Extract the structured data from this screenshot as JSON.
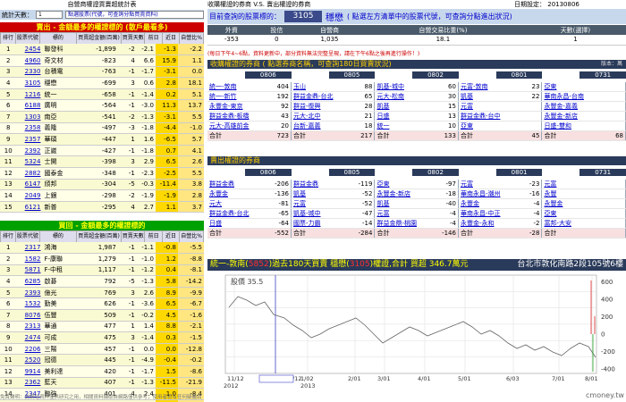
{
  "left": {
    "title": "自營商權證買賣超統計表",
    "days_label": "統計天數：",
    "days_value": "1",
    "search_placeholder": "點選股票(代號，可查詢分點買賣資料)",
    "sell_header": "賣出 - 金額最多的權證標的 (散戶最看多)",
    "buy_header": "買回 - 金額最多的權證標的",
    "columns": [
      "排行",
      "股票代號",
      "標的",
      "買賣超金額(百萬)",
      "買賣天數",
      "前日",
      "近日",
      "自營比%"
    ],
    "sell_rows": [
      [
        "1",
        "2454",
        "聯發科",
        "-1,899",
        "-2",
        "-2.1",
        "-1.3",
        "-2.2"
      ],
      [
        "2",
        "4960",
        "奇文材",
        "-823",
        "4",
        "6.6",
        "15.9",
        "1.1"
      ],
      [
        "3",
        "2330",
        "台積電",
        "-763",
        "-1",
        "-1.7",
        "-3.1",
        "0.0"
      ],
      [
        "4",
        "3105",
        "穩懋",
        "-699",
        "3",
        "0.6",
        "2.8",
        "18.1"
      ],
      [
        "5",
        "1216",
        "統一",
        "-658",
        "-1",
        "-1.4",
        "0.2",
        "5.1"
      ],
      [
        "6",
        "6188",
        "廣明",
        "-564",
        "-1",
        "-3.0",
        "11.3",
        "13.7"
      ],
      [
        "7",
        "1303",
        "南亞",
        "-541",
        "-2",
        "-1.3",
        "-3.1",
        "5.5"
      ],
      [
        "8",
        "2358",
        "義隆",
        "-497",
        "-3",
        "-1.8",
        "-4.4",
        "-1.0"
      ],
      [
        "9",
        "2357",
        "華碩",
        "-447",
        "1",
        "1.6",
        "-6.5",
        "5.7"
      ],
      [
        "10",
        "2392",
        "正崴",
        "-427",
        "-1",
        "-1.8",
        "0.7",
        "4.1"
      ],
      [
        "11",
        "5324",
        "士開",
        "-398",
        "3",
        "2.9",
        "6.5",
        "2.6"
      ],
      [
        "12",
        "2882",
        "國泰金",
        "-348",
        "-1",
        "-2.3",
        "-2.5",
        "5.5"
      ],
      [
        "13",
        "6147",
        "頎邦",
        "-304",
        "-5",
        "-0.3",
        "-11.4",
        "3.8"
      ],
      [
        "14",
        "2049",
        "上銀",
        "-298",
        "-2",
        "-1.9",
        "-1.9",
        "2.8"
      ],
      [
        "15",
        "6121",
        "新普",
        "-295",
        "4",
        "2.7",
        "1.1",
        "3.7"
      ]
    ],
    "buy_rows": [
      [
        "1",
        "2317",
        "鴻海",
        "1,987",
        "-1",
        "-1.1",
        "-0.8",
        "-5.5"
      ],
      [
        "2",
        "1582",
        "F-康聯",
        "1,279",
        "-1",
        "-1.0",
        "1.2",
        "-8.8"
      ],
      [
        "3",
        "5871",
        "F-中租",
        "1,117",
        "-1",
        "-1.2",
        "0.4",
        "-8.1"
      ],
      [
        "4",
        "6285",
        "啟碁",
        "792",
        "-5",
        "-1.3",
        "5.8",
        "-14.2"
      ],
      [
        "5",
        "2393",
        "億光",
        "769",
        "3",
        "2.6",
        "8.9",
        "-9.9"
      ],
      [
        "6",
        "1532",
        "勤美",
        "626",
        "-1",
        "-3.6",
        "6.5",
        "-6.7"
      ],
      [
        "7",
        "8076",
        "伍豐",
        "509",
        "-1",
        "-0.2",
        "4.5",
        "-1.6"
      ],
      [
        "8",
        "2313",
        "華通",
        "477",
        "1",
        "1.4",
        "8.8",
        "-2.1"
      ],
      [
        "9",
        "2474",
        "可成",
        "475",
        "3",
        "-1.4",
        "0.3",
        "-1.5"
      ],
      [
        "10",
        "2206",
        "三陽",
        "457",
        "-1",
        "0.0",
        "0.0",
        "-12.8"
      ],
      [
        "11",
        "2520",
        "冠德",
        "445",
        "-1",
        "-4.9",
        "-0.4",
        "-0.2"
      ],
      [
        "12",
        "9914",
        "美利達",
        "420",
        "-1",
        "-1.7",
        "1.5",
        "-8.6"
      ],
      [
        "13",
        "2362",
        "藍天",
        "407",
        "-1",
        "-1.3",
        "-11.5",
        "-21.9"
      ],
      [
        "14",
        "2347",
        "聯強",
        "401",
        "4",
        "2.4",
        "1.0",
        "-8.4"
      ],
      [
        "15",
        "3008",
        "大立光",
        "357",
        "-1",
        "-1.3",
        "-7.3",
        "-5.7"
      ]
    ],
    "footer": "免責聲明：此網站資料僅供研究之用，相關資料擷取自網路僅供參考，使用者若有任何疑義請以..."
  },
  "right": {
    "title": "收購權證的券商 V.S. 賣出權證的券商",
    "date_label": "日期設定：",
    "date_value": "20130806",
    "query_label": "目前查詢的股票標的：",
    "stock_code": "3105",
    "stock_name": "穩懋",
    "query_hint": "( 點選左方清單中的股票代號，可查詢分點進出狀況)",
    "summary_headers": [
      "外資",
      "投信",
      "自營商",
      "自營交易比重(%)",
      "天數(選擇)"
    ],
    "summary_values": [
      "-353",
      "0",
      "1,035",
      "18.1",
      "1"
    ],
    "note": "(每日下午4~6點，資料更新中，部分資料無法完整呈現，請在下午6點之後再進行操作！)",
    "version": "版本：萬元",
    "buy_brokers_head": "收購權證的券商 ( 點選券商名稱，可查詢180日買賣狀況)",
    "sell_brokers_head": "賣出權證的券商",
    "date_cols": [
      "0806",
      "0805",
      "0802",
      "0801",
      "0731"
    ],
    "buy_brokers": [
      [
        [
          "統一-敦南",
          "404"
        ],
        [
          "玉山",
          "88"
        ],
        [
          "凱基-城中",
          "60"
        ],
        [
          "元富-敦南",
          "23"
        ],
        [
          "亞東",
          ""
        ]
      ],
      [
        [
          "統一-新竹",
          "192"
        ],
        [
          "群益金鼎-台北",
          "65"
        ],
        [
          "元大-松南",
          "30"
        ],
        [
          "凱基",
          "22"
        ],
        [
          "華南永昌-台南",
          ""
        ]
      ],
      [
        [
          "永豐金-東京",
          "92"
        ],
        [
          "群益-復興",
          "28"
        ],
        [
          "凱基",
          "15"
        ],
        [
          "元富",
          "",
          ""
        ],
        [
          "永豐金-嘉義",
          ""
        ]
      ],
      [
        [
          "群益金鼎-板橋",
          "43"
        ],
        [
          "元大-北中",
          "21"
        ],
        [
          "日盛",
          "13"
        ],
        [
          "群益金鼎-台中",
          ""
        ],
        [
          "永豐金-新店",
          ""
        ]
      ],
      [
        [
          "元大-高雄前金",
          "20"
        ],
        [
          "台新-嘉義",
          "18"
        ],
        [
          "統一",
          "10"
        ],
        [
          "亞東",
          ""
        ],
        [
          "日盛-雙和",
          ""
        ]
      ]
    ],
    "buy_brokers_vals": [
      [
        "404",
        "88",
        "60",
        "23",
        ""
      ],
      [
        "192",
        "65",
        "30",
        "22",
        ""
      ],
      [
        "92",
        "28",
        "15",
        "",
        ""
      ],
      [
        "43",
        "21",
        "13",
        "",
        ""
      ],
      [
        "20",
        "18",
        "10",
        "",
        ""
      ]
    ],
    "buy_totals": [
      "723",
      "217",
      "133",
      "45",
      "68"
    ],
    "sell_brokers": [
      [
        [
          "群益金鼎",
          "-206"
        ],
        [
          "群益金鼎",
          "-119"
        ],
        [
          "亞東",
          "-97"
        ],
        [
          "元富",
          "-23"
        ],
        [
          "元富",
          ""
        ]
      ],
      [
        [
          "永豐金",
          "-136"
        ],
        [
          "凱基",
          "-52"
        ],
        [
          "永豐金-新店",
          "-18"
        ],
        [
          "華南永昌-潮州",
          "-16"
        ],
        [
          "永豐",
          ""
        ]
      ],
      [
        [
          "元大",
          "-81"
        ],
        [
          "元富",
          "-52"
        ],
        [
          "凱基",
          "-40"
        ],
        [
          "永豐金",
          "-4"
        ],
        [
          "永豐金",
          ""
        ]
      ],
      [
        [
          "群益金鼎-台北",
          "-65"
        ],
        [
          "凱基-城中",
          "-47"
        ],
        [
          "元富",
          "-4"
        ],
        [
          "華南永昌-中正",
          "-4"
        ],
        [
          "亞東",
          ""
        ]
      ],
      [
        [
          "日盛",
          "-64"
        ],
        [
          "國票-力霸",
          "-14"
        ],
        [
          "群益金鼎-桃園",
          "-4"
        ],
        [
          "永豐金-永和",
          "-2"
        ],
        [
          "富邦-大安",
          ""
        ]
      ]
    ],
    "sell_totals": [
      "-552",
      "-284",
      "-146",
      "-28",
      ""
    ],
    "total_label": "合計",
    "graph_title_a": "統一-敦南(",
    "graph_code_a": "5852",
    "graph_title_b": ")過去180天買賣 穩懋(",
    "graph_code_b": "3105",
    "graph_title_c": ")權證,合計  買超 346.7萬元",
    "graph_addr": "台北市敦化南路2段105號6樓",
    "graph_price_label": "股價 35.5",
    "graph_y_right": [
      "600",
      "400",
      "200",
      "0",
      "-200",
      "-400"
    ],
    "graph_x": [
      "11/12",
      "2012/12/12",
      "1/02",
      "2/01",
      "3/01",
      "4/01",
      "5/01",
      "6/03",
      "7/01",
      "8/01"
    ],
    "graph_year_a": "2012",
    "graph_year_b": "2013",
    "watermark": "cmoney.tw"
  }
}
